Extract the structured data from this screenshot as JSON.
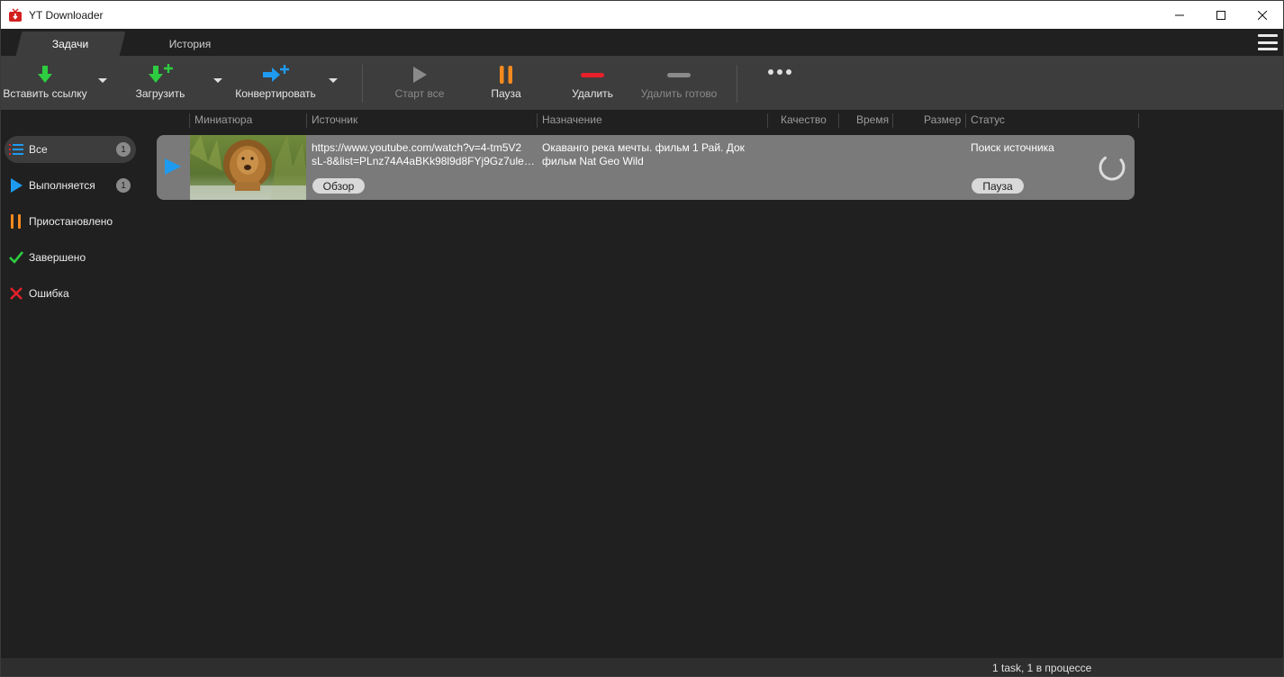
{
  "window": {
    "title": "YT Downloader",
    "icon": "yt-downloader-app-icon",
    "controls": [
      "minimize-icon",
      "maximize-icon",
      "close-icon"
    ]
  },
  "tabs": [
    {
      "label": "Задачи",
      "active": true
    },
    {
      "label": "История",
      "active": false
    }
  ],
  "toolbar": {
    "paste_link": {
      "label": "Вставить ссылку",
      "icon": "download-arrow-icon",
      "color": "#2ecc40"
    },
    "download": {
      "label": "Загрузить",
      "icon": "download-add-icon",
      "color": "#2ecc40"
    },
    "convert": {
      "label": "Конвертировать",
      "icon": "convert-add-icon",
      "color": "#1e9bf0"
    },
    "start_all": {
      "label": "Старт все",
      "icon": "play-icon",
      "enabled": false
    },
    "pause": {
      "label": "Пауза",
      "icon": "pause-icon",
      "color": "#f58a1f"
    },
    "delete": {
      "label": "Удалить",
      "icon": "minus-icon",
      "color": "#e8202a"
    },
    "delete_done": {
      "label": "Удалить готово",
      "icon": "minus-icon",
      "enabled": false
    },
    "more": {
      "icon": "more-dots-icon"
    }
  },
  "columns": [
    "Миниатюра",
    "Источник",
    "Назначение",
    "Качество",
    "Время",
    "Размер",
    "Статус"
  ],
  "sidebar": {
    "items": [
      {
        "label": "Все",
        "icon": "list-icon",
        "count": "1",
        "active": true
      },
      {
        "label": "Выполняется",
        "icon": "play-icon",
        "count": "1",
        "active": false
      },
      {
        "label": "Приостановлено",
        "icon": "pause-icon",
        "active": false
      },
      {
        "label": "Завершено",
        "icon": "check-icon",
        "active": false
      },
      {
        "label": "Ошибка",
        "icon": "error-x-icon",
        "active": false
      }
    ]
  },
  "task": {
    "thumbnail": "lion-in-water-thumbnail",
    "source_line1": "https://www.youtube.com/watch?v=4-tm5V2",
    "source_line2": "sL-8&list=PLnz74A4aBKk98l9d8FYj9Gz7ule8s...",
    "browse_label": "Обзор",
    "destination": "Окаванго река мечты. фильм 1  Рай. Док фильм Nat Geo Wild",
    "status": "Поиск источника",
    "pause_label": "Пауза"
  },
  "statusbar": {
    "summary": "1 task, 1 в процессе"
  },
  "colors": {
    "toolbar_bg": "#3d3d3d",
    "window_bg": "#202020",
    "task_row_bg": "#7a7a7a",
    "accent_blue": "#1e9bf0",
    "accent_green": "#2ecc40",
    "accent_orange": "#f58a1f",
    "accent_red": "#e8202a"
  }
}
